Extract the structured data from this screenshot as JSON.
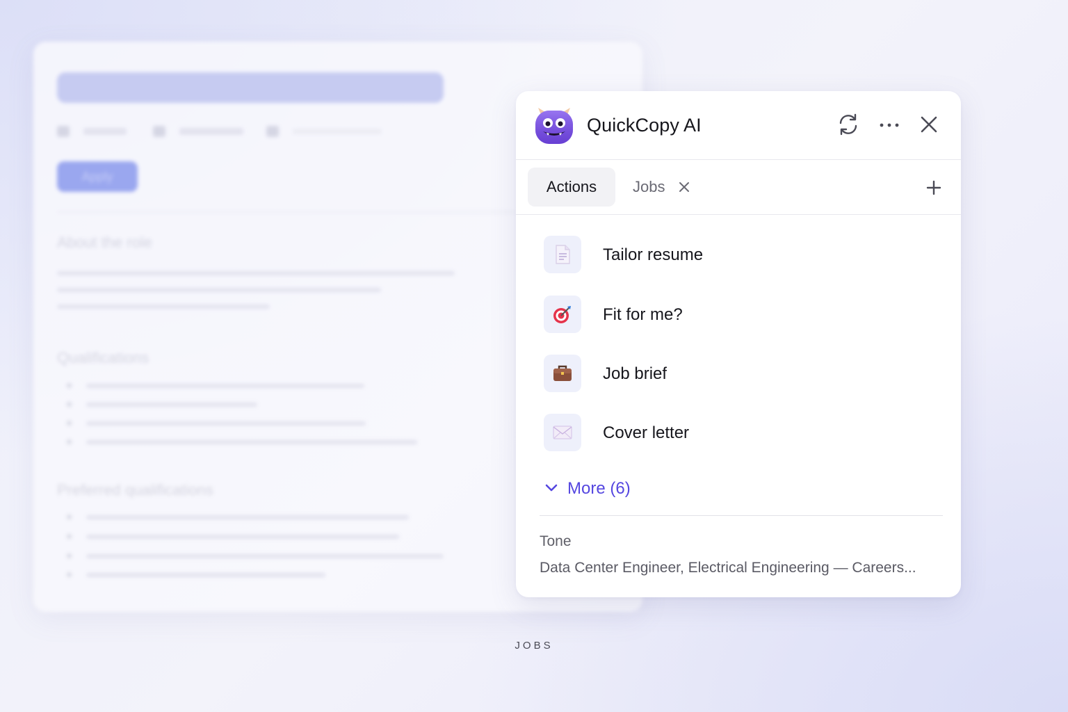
{
  "panel": {
    "app_title": "QuickCopy AI",
    "header_icons": [
      "refresh-icon",
      "more-options-icon",
      "close-icon"
    ],
    "tabs": [
      {
        "label": "Actions",
        "active": true
      },
      {
        "label": "Jobs",
        "active": false,
        "closable": true
      }
    ],
    "actions": [
      {
        "label": "Tailor resume",
        "icon": "document-icon"
      },
      {
        "label": "Fit for me?",
        "icon": "target-icon"
      },
      {
        "label": "Job brief",
        "icon": "briefcase-icon"
      },
      {
        "label": "Cover letter",
        "icon": "envelope-icon"
      }
    ],
    "more_label": "More (6)",
    "tone": {
      "label": "Tone",
      "value": "Data Center Engineer, Electrical Engineering — Careers..."
    }
  },
  "background_page": {
    "apply_label": "Apply",
    "sections": [
      "About the role",
      "Qualifications",
      "Preferred qualifications"
    ]
  },
  "caption": "JOBS",
  "colors": {
    "accent": "#5547e0",
    "logo_purple": "#7b4fe3",
    "panel_bg": "#ffffff",
    "icon_tile_bg": "#eef0fb"
  }
}
